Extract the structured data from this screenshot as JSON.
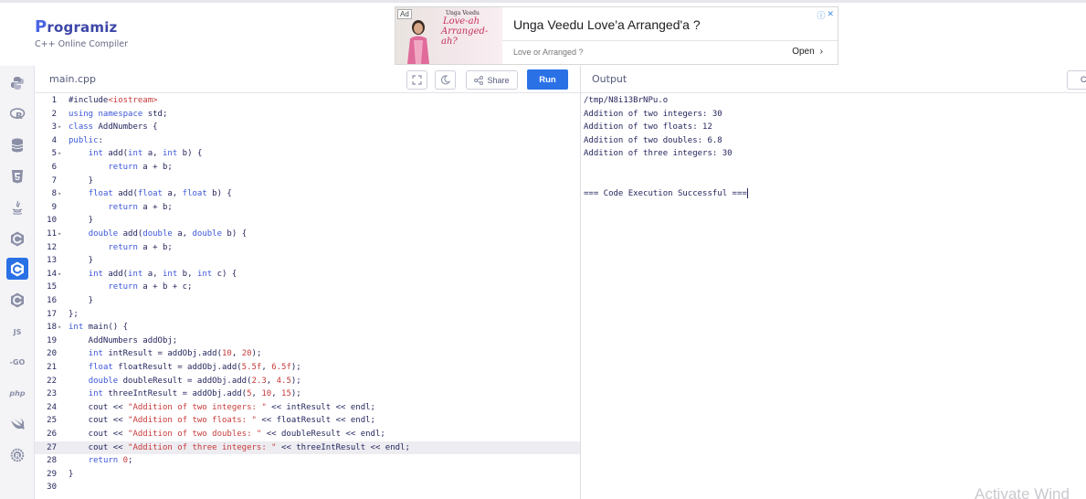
{
  "brand": {
    "name": "rogramiz",
    "name_initial": "P",
    "subtitle": "C++ Online Compiler",
    "color": "#3d47a8"
  },
  "ad": {
    "badge": "Ad",
    "image_text_top": "Unga Veedu",
    "image_text_line1": "Love-ah",
    "image_text_line2": "Arranged-ah?",
    "title": "Unga Veedu Love'a Arranged'a ?",
    "subtitle": "Love or Arranged ?",
    "open_label": "Open",
    "info_icons": [
      "info-icon",
      "close-icon"
    ]
  },
  "sidebar": {
    "items": [
      {
        "name": "python",
        "icon": "python-icon"
      },
      {
        "name": "r",
        "icon": "r-icon"
      },
      {
        "name": "sql",
        "icon": "database-icon"
      },
      {
        "name": "html",
        "icon": "html5-icon"
      },
      {
        "name": "java",
        "icon": "java-icon"
      },
      {
        "name": "c",
        "icon": "c-icon"
      },
      {
        "name": "cpp",
        "icon": "cpp-icon",
        "active": true
      },
      {
        "name": "csharp",
        "icon": "csharp-icon"
      },
      {
        "name": "javascript",
        "label": "JS"
      },
      {
        "name": "go",
        "label": "-GO"
      },
      {
        "name": "php",
        "label": "php"
      },
      {
        "name": "swift",
        "icon": "swift-icon"
      },
      {
        "name": "rust",
        "icon": "rust-icon"
      }
    ],
    "active_color": "#2a71e6"
  },
  "editor": {
    "file_name": "main.cpp",
    "share_label": "Share",
    "run_label": "Run",
    "highlighted_line": 27,
    "lines": [
      {
        "n": "1",
        "fold": "",
        "code": "#include<iostream>"
      },
      {
        "n": "2",
        "fold": "",
        "code": "using namespace std;"
      },
      {
        "n": "3",
        "fold": "▾",
        "code": "class AddNumbers {"
      },
      {
        "n": "4",
        "fold": "",
        "code": "public:"
      },
      {
        "n": "5",
        "fold": "▾",
        "code": "    int add(int a, int b) {"
      },
      {
        "n": "6",
        "fold": "",
        "code": "        return a + b;"
      },
      {
        "n": "7",
        "fold": "",
        "code": "    }"
      },
      {
        "n": "8",
        "fold": "▾",
        "code": "    float add(float a, float b) {"
      },
      {
        "n": "9",
        "fold": "",
        "code": "        return a + b;"
      },
      {
        "n": "10",
        "fold": "",
        "code": "    }"
      },
      {
        "n": "11",
        "fold": "▾",
        "code": "    double add(double a, double b) {"
      },
      {
        "n": "12",
        "fold": "",
        "code": "        return a + b;"
      },
      {
        "n": "13",
        "fold": "",
        "code": "    }"
      },
      {
        "n": "14",
        "fold": "▾",
        "code": "    int add(int a, int b, int c) {"
      },
      {
        "n": "15",
        "fold": "",
        "code": "        return a + b + c;"
      },
      {
        "n": "16",
        "fold": "",
        "code": "    }"
      },
      {
        "n": "17",
        "fold": "",
        "code": "};"
      },
      {
        "n": "18",
        "fold": "▾",
        "code": "int main() {"
      },
      {
        "n": "19",
        "fold": "",
        "code": "    AddNumbers addObj;"
      },
      {
        "n": "20",
        "fold": "",
        "code": "    int intResult = addObj.add(10, 20);"
      },
      {
        "n": "21",
        "fold": "",
        "code": "    float floatResult = addObj.add(5.5f, 6.5f);"
      },
      {
        "n": "22",
        "fold": "",
        "code": "    double doubleResult = addObj.add(2.3, 4.5);"
      },
      {
        "n": "23",
        "fold": "",
        "code": "    int threeIntResult = addObj.add(5, 10, 15);"
      },
      {
        "n": "24",
        "fold": "",
        "code": "    cout << \"Addition of two integers: \" << intResult << endl;"
      },
      {
        "n": "25",
        "fold": "",
        "code": "    cout << \"Addition of two floats: \" << floatResult << endl;"
      },
      {
        "n": "26",
        "fold": "",
        "code": "    cout << \"Addition of two doubles: \" << doubleResult << endl;"
      },
      {
        "n": "27",
        "fold": "",
        "code": "    cout << \"Addition of three integers: \" << threeIntResult << endl;"
      },
      {
        "n": "28",
        "fold": "",
        "code": "    return 0;"
      },
      {
        "n": "29",
        "fold": "",
        "code": "}"
      },
      {
        "n": "30",
        "fold": "",
        "code": ""
      }
    ]
  },
  "output": {
    "title": "Output",
    "clear_label": "C",
    "lines": [
      "/tmp/N8i13BrNPu.o",
      "Addition of two integers: 30",
      "Addition of two floats: 12",
      "Addition of two doubles: 6.8",
      "Addition of three integers: 30",
      "",
      "",
      "=== Code Execution Successful ==="
    ]
  },
  "watermark": "Activate Wind"
}
